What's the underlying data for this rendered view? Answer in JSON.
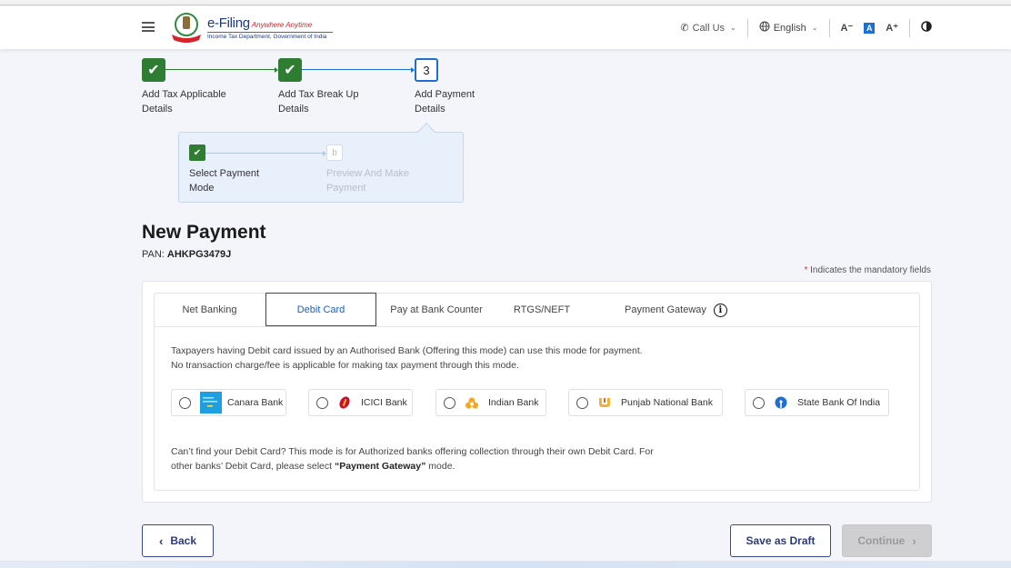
{
  "header": {
    "brand_main": "e-Filing",
    "brand_tagline": "Anywhere Anytime",
    "brand_sub": "Income Tax Department, Government of India",
    "call_us": "Call Us",
    "language": "English",
    "font_decrease": "A⁻",
    "font_normal": "A",
    "font_increase": "A⁺"
  },
  "stepper": {
    "steps": [
      {
        "label": "Add Tax Applicable Details",
        "status": "done",
        "marker": "✔"
      },
      {
        "label": "Add Tax Break Up Details",
        "status": "done",
        "marker": "✔"
      },
      {
        "label": "Add Payment Details",
        "status": "current",
        "marker": "3"
      }
    ],
    "substeps": [
      {
        "label": "Select Payment Mode",
        "status": "done",
        "marker": "✔"
      },
      {
        "label": "Preview And Make Payment",
        "status": "pending",
        "marker": "b"
      }
    ]
  },
  "page": {
    "title": "New Payment",
    "pan_label": "PAN:",
    "pan_value": "AHKPG3479J",
    "mandatory_star": "*",
    "mandatory_text": "Indicates the mandatory fields"
  },
  "tabs": [
    {
      "label": "Net Banking",
      "active": false
    },
    {
      "label": "Debit Card",
      "active": true
    },
    {
      "label": "Pay at Bank Counter",
      "active": false
    },
    {
      "label": "RTGS/NEFT",
      "active": false
    },
    {
      "label": "Payment Gateway",
      "active": false
    }
  ],
  "debit_card": {
    "description": "Taxpayers having Debit card issued by an Authorised Bank (Offering this mode) can use this mode for payment. No transaction charge/fee is applicable for making tax payment through this mode.",
    "banks": [
      {
        "name": "Canara Bank",
        "selected": false,
        "logo": "canara-logo",
        "color": "#1ea0e0"
      },
      {
        "name": "ICICI Bank",
        "selected": false,
        "logo": "icici-logo",
        "color": "#c8102e"
      },
      {
        "name": "Indian Bank",
        "selected": false,
        "logo": "indian-bank-logo",
        "color": "#f5a623"
      },
      {
        "name": "Punjab National Bank",
        "selected": false,
        "logo": "pnb-logo",
        "color": "#f2b233"
      },
      {
        "name": "State Bank Of India",
        "selected": false,
        "logo": "sbi-logo",
        "color": "#1e6fd1"
      }
    ],
    "note_prefix": "Can’t find your Debit Card? This mode is for Authorized banks offering collection through their own Debit Card. For other banks’ Debit Card, please select ",
    "note_bold": "“Payment Gateway”",
    "note_suffix": " mode."
  },
  "actions": {
    "back": "Back",
    "save_draft": "Save as Draft",
    "continue": "Continue"
  },
  "colors": {
    "done_green": "#2e7d32",
    "current_blue": "#1e6fd1",
    "primary_navy": "#2b3a7f"
  }
}
